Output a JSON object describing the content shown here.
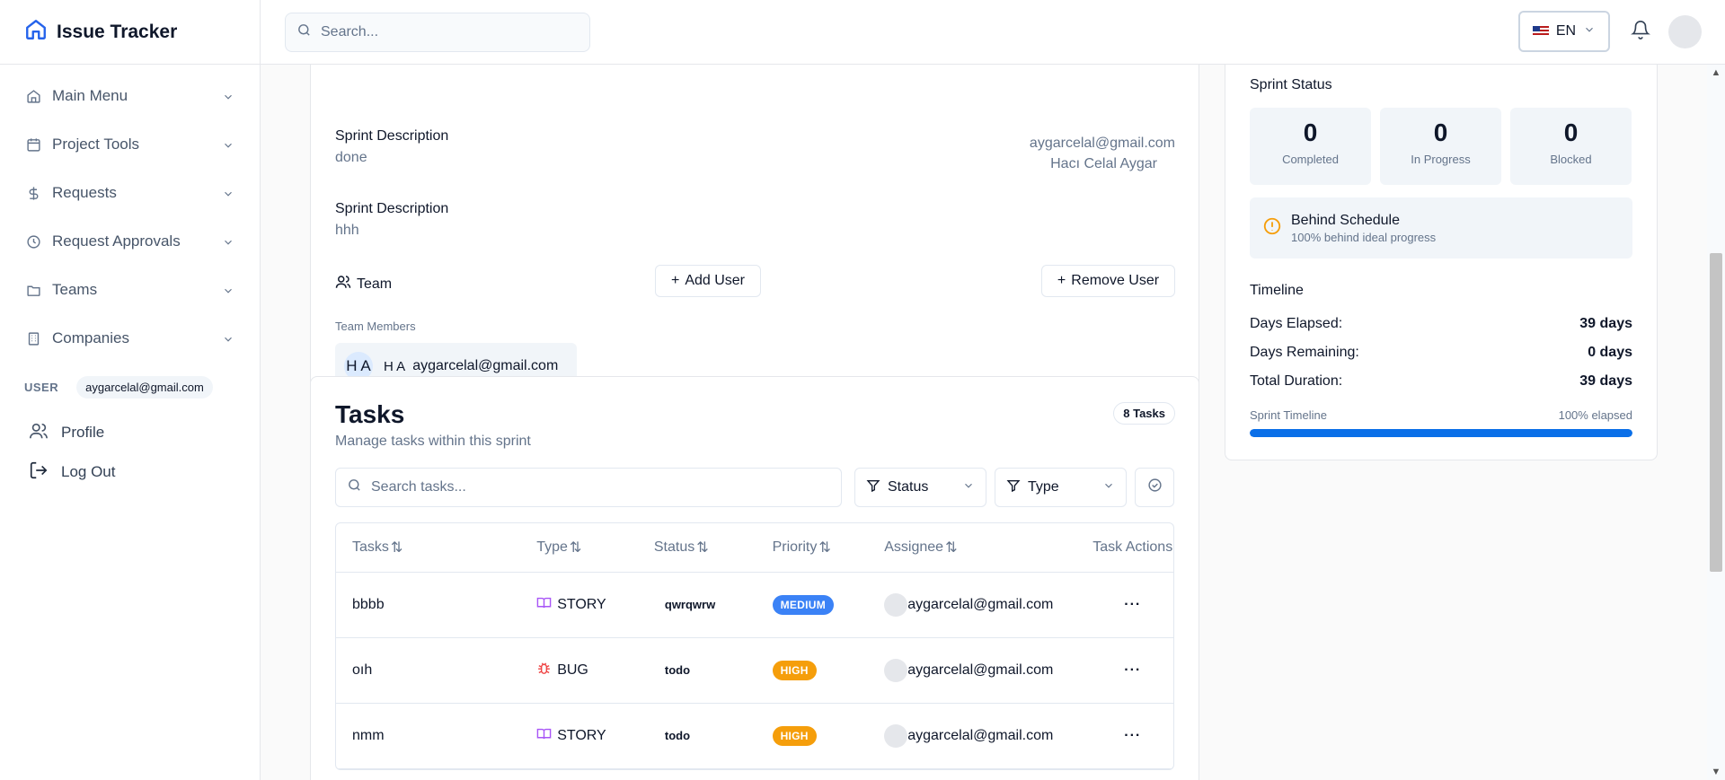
{
  "brand": {
    "title": "Issue Tracker"
  },
  "search": {
    "placeholder": "Search..."
  },
  "language": {
    "code": "EN"
  },
  "sidebar": {
    "items": [
      {
        "label": "Main Menu",
        "icon": "home-icon"
      },
      {
        "label": "Project Tools",
        "icon": "calendar-icon"
      },
      {
        "label": "Requests",
        "icon": "dollar-icon"
      },
      {
        "label": "Request Approvals",
        "icon": "clock-icon"
      },
      {
        "label": "Teams",
        "icon": "folder-icon"
      },
      {
        "label": "Companies",
        "icon": "building-icon"
      }
    ],
    "user_label": "USER",
    "user_email": "aygarcelal@gmail.com",
    "profile_label": "Profile",
    "logout_label": "Log Out"
  },
  "sprint": {
    "desc1_label": "Sprint Description",
    "desc1_value": "done",
    "desc2_label": "Sprint Description",
    "desc2_value": "hhh",
    "owner_email": "aygarcelal@gmail.com",
    "owner_name": "Hacı Celal Aygar",
    "team_label": "Team",
    "add_user": "Add User",
    "remove_user": "Remove User",
    "team_members_label": "Team Members",
    "member": {
      "avatar": "H A",
      "initials": "H A",
      "email": "aygarcelal@gmail.com"
    }
  },
  "tasks": {
    "title": "Tasks",
    "subtitle": "Manage tasks within this sprint",
    "count": "8 Tasks",
    "search_placeholder": "Search tasks...",
    "filter_status": "Status",
    "filter_type": "Type",
    "columns": [
      "Tasks",
      "Type",
      "Status",
      "Priority",
      "Assignee",
      "Task Actions"
    ],
    "rows": [
      {
        "name": "bbbb",
        "type": "STORY",
        "status": "qwrqwrw",
        "priority": "MEDIUM",
        "assignee": "aygarcelal@gmail.com"
      },
      {
        "name": "oıh",
        "type": "BUG",
        "status": "todo",
        "priority": "HIGH",
        "assignee": "aygarcelal@gmail.com"
      },
      {
        "name": "nmm",
        "type": "STORY",
        "status": "todo",
        "priority": "HIGH",
        "assignee": "aygarcelal@gmail.com"
      }
    ]
  },
  "status_panel": {
    "title": "Sprint Status",
    "stats": [
      {
        "value": "0",
        "label": "Completed"
      },
      {
        "value": "0",
        "label": "In Progress"
      },
      {
        "value": "0",
        "label": "Blocked"
      }
    ],
    "alert_title": "Behind Schedule",
    "alert_sub": "100% behind ideal progress",
    "timeline_title": "Timeline",
    "timeline": [
      {
        "label": "Days Elapsed:",
        "value": "39 days"
      },
      {
        "label": "Days Remaining:",
        "value": "0 days"
      },
      {
        "label": "Total Duration:",
        "value": "39 days"
      }
    ],
    "bar_label": "Sprint Timeline",
    "bar_value_label": "100% elapsed",
    "bar_fraction": 1.0
  },
  "colors": {
    "accent": "#0a6fe8",
    "medium": "#3b82f6",
    "high": "#f59e0b",
    "warning": "#f59e0b",
    "story": "#a855f7",
    "bug": "#ef4444"
  }
}
